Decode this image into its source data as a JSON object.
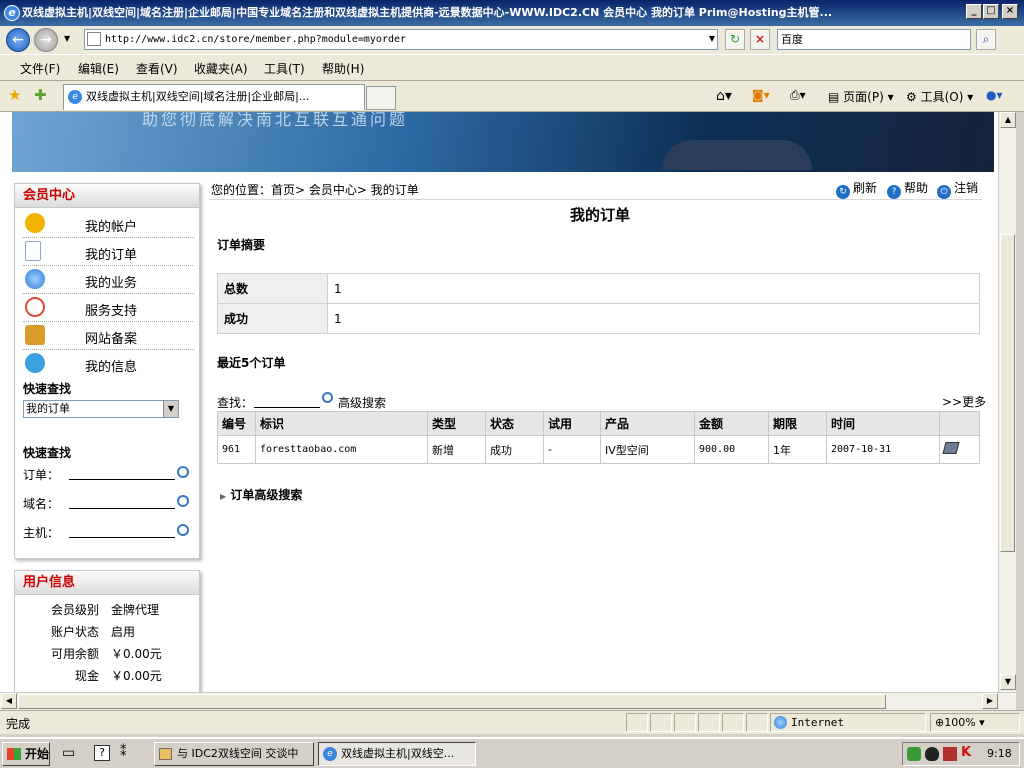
{
  "window": {
    "title": "双线虚拟主机|双线空间|域名注册|企业邮局|中国专业域名注册和双线虚拟主机提供商-远景数据中心-WWW.IDC2.CN 会员中心 我的订单 Prim@Hosting主机管..."
  },
  "address": {
    "url": "http://www.idc2.cn/store/member.php?module=myorder",
    "search_placeholder": "百度"
  },
  "menu": [
    "文件(F)",
    "编辑(E)",
    "查看(V)",
    "收藏夹(A)",
    "工具(T)",
    "帮助(H)"
  ],
  "tab": {
    "title": "双线虚拟主机|双线空间|域名注册|企业邮局|...",
    "page_label": "页面(P)",
    "tools_label": "工具(O)"
  },
  "banner": {
    "slogan": "助您彻底解决南北互联互通问题"
  },
  "sidebar": {
    "member_center": "会员中心",
    "items": [
      {
        "label": "我的帐户",
        "icon": "coins-icon",
        "color": "#f2b400"
      },
      {
        "label": "我的订单",
        "icon": "document-icon",
        "color": "#bfd7f2"
      },
      {
        "label": "我的业务",
        "icon": "globe-icon",
        "color": "#2f7bd6"
      },
      {
        "label": "服务支持",
        "icon": "support-icon",
        "color": "#e04a3a"
      },
      {
        "label": "网站备案",
        "icon": "certificate-icon",
        "color": "#d89c2a"
      },
      {
        "label": "我的信息",
        "icon": "user-info-icon",
        "color": "#3aa0e0"
      }
    ],
    "quick_find_label": "快速查找",
    "quick_find_select": "我的订单",
    "quick_find2_label": "快速查找",
    "quick_fields": [
      "订单：",
      "域名：",
      "主机："
    ],
    "user_info_title": "用户信息",
    "user_info": [
      {
        "k": "会员级别",
        "v": "金牌代理"
      },
      {
        "k": "账户状态",
        "v": "启用"
      },
      {
        "k": "可用余额",
        "v": "￥0.00元"
      },
      {
        "k": "现金",
        "v": "￥0.00元"
      }
    ]
  },
  "main": {
    "breadcrumb": "您的位置：首页> 会员中心> 我的订单",
    "refresh": "刷新",
    "help": "帮助",
    "logout": "注销",
    "title": "我的订单",
    "summary_title": "订单摘要",
    "summary": [
      {
        "k": "总数",
        "v": "1"
      },
      {
        "k": "成功",
        "v": "1"
      }
    ],
    "recent_title": "最近5个订单",
    "search_label": "查找：",
    "advanced_search": "高级搜索",
    "more": ">>更多",
    "columns": [
      "编号",
      "标识",
      "类型",
      "状态",
      "试用",
      "产品",
      "金额",
      "期限",
      "时间",
      ""
    ],
    "rows": [
      {
        "id": "961",
        "name": "foresttaobao.com",
        "type": "新增",
        "status": "成功",
        "trial": "-",
        "product": "IV型空间",
        "amount": "900.00",
        "term": "1年",
        "time": "2007-10-31"
      }
    ],
    "order_adv_search": "订单高级搜索"
  },
  "status": {
    "text": "完成",
    "zone": "Internet",
    "zoom": "100%"
  },
  "taskbar": {
    "start": "开始",
    "tasks": [
      "与 IDC2双线空间 交谈中",
      "双线虚拟主机|双线空..."
    ],
    "clock": "9:18"
  }
}
